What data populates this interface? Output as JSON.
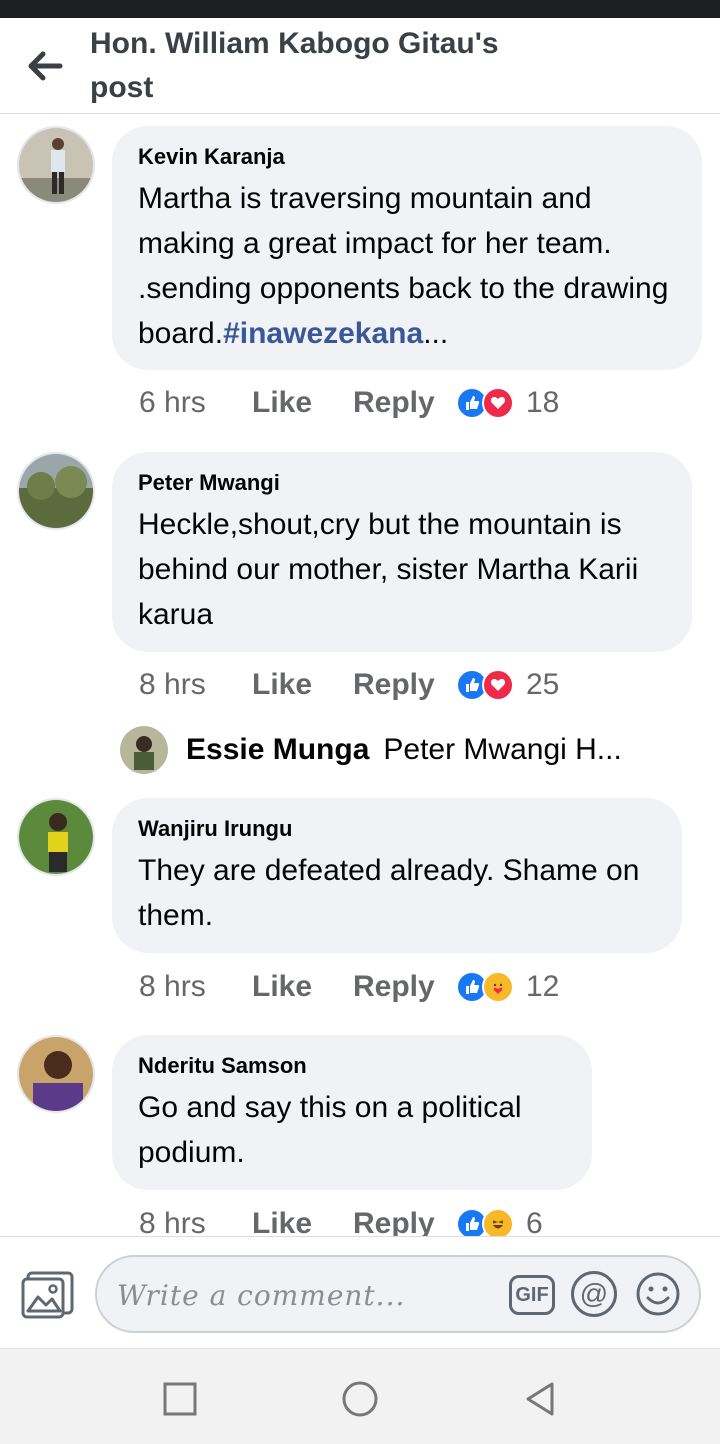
{
  "header": {
    "title": "Hon. William Kabogo Gitau's post",
    "back_icon": "arrow-left-icon"
  },
  "comments": [
    {
      "author": "Kevin Karanja",
      "text": "Martha is traversing mountain and making a great impact for her team. .sending opponents back to the drawing board.",
      "hashtag": "#inawezekana",
      "ellipsis": "...",
      "time": "6 hrs",
      "like": "Like",
      "reply": "Reply",
      "reactions": [
        "like",
        "love"
      ],
      "count": "18"
    },
    {
      "author": "Peter Mwangi",
      "text": "Heckle,shout,cry but the mountain is behind our mother, sister Martha Karii karua",
      "time": "8 hrs",
      "like": "Like",
      "reply": "Reply",
      "reactions": [
        "like",
        "love"
      ],
      "count": "25"
    },
    {
      "author": "Wanjiru Irungu",
      "text": "They are defeated already.  Shame on them.",
      "time": "8 hrs",
      "like": "Like",
      "reply": "Reply",
      "reactions": [
        "like",
        "care"
      ],
      "count": "12"
    },
    {
      "author": "Nderitu Samson",
      "text": "Go and say this on a political podium.",
      "time": "8 hrs",
      "like": "Like",
      "reply": "Reply",
      "reactions": [
        "like",
        "haha"
      ],
      "count": "6"
    }
  ],
  "reply_preview": {
    "author": "Essie Munga",
    "text": "Peter Mwangi H..."
  },
  "composer": {
    "placeholder": "Write a comment...",
    "gif_label": "GIF",
    "at_label": "@"
  },
  "colors": {
    "bubble": "#f0f2f5",
    "link": "#385898",
    "like": "#1877f2",
    "love": "#f02849"
  }
}
